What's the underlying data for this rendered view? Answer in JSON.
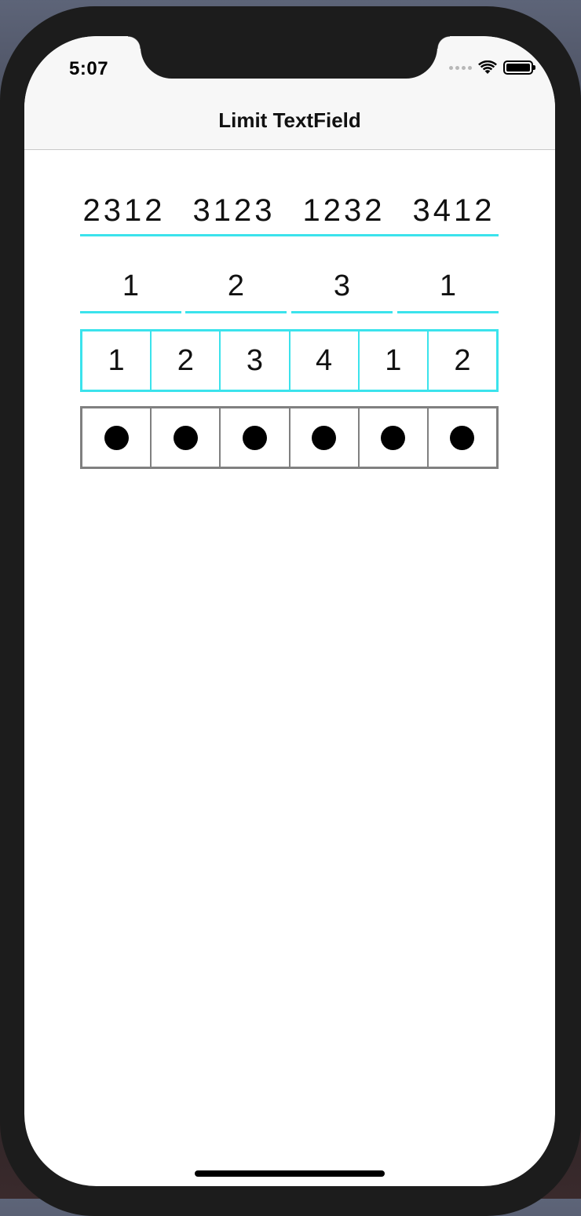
{
  "status_bar": {
    "time": "5:07",
    "icons": [
      "signal-icon",
      "wifi-icon",
      "battery-icon"
    ]
  },
  "nav": {
    "title": "Limit TextField"
  },
  "fields": {
    "grouped_code": {
      "groups": [
        "2312",
        "3123",
        "1232",
        "3412"
      ]
    },
    "underline_boxes": {
      "values": [
        "1",
        "2",
        "3",
        "1"
      ]
    },
    "bordered_boxes": {
      "values": [
        "1",
        "2",
        "3",
        "4",
        "1",
        "2"
      ]
    },
    "secure_boxes": {
      "filled_count": 6,
      "total_count": 6
    }
  },
  "colors": {
    "accent": "#3be3ec",
    "secure_border": "#808080"
  }
}
